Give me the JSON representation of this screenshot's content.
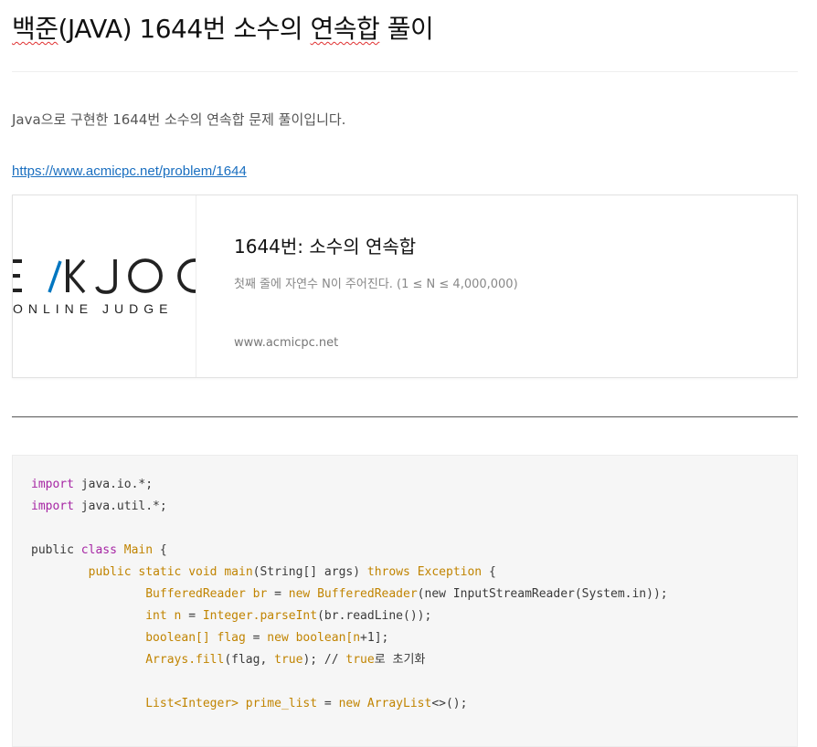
{
  "post": {
    "title_part1": "백준",
    "title_part2": "(JAVA) 1644번 소수의 ",
    "title_part3": "연속합",
    "title_part4": " 풀이",
    "intro": "Java으로 구현한 1644번 소수의 연속합 문제 풀이입니다.",
    "link": "https://www.acmicpc.net/problem/1644"
  },
  "card": {
    "logo_main": "EKJOO",
    "logo_sub": "ONLINE JUDGE",
    "title": "1644번: 소수의 연속합",
    "description": "첫째 줄에 자연수 N이 주어진다. (1 ≤ N ≤ 4,000,000)",
    "site": "www.acmicpc.net"
  },
  "code": {
    "lines": [
      [
        {
          "t": "import",
          "c": "kw"
        },
        {
          "t": " java.io.*;",
          "c": "plain"
        }
      ],
      [
        {
          "t": "import",
          "c": "kw"
        },
        {
          "t": " java.util.*;",
          "c": "plain"
        }
      ],
      [],
      [
        {
          "t": "public ",
          "c": "plain"
        },
        {
          "t": "class",
          "c": "kw"
        },
        {
          "t": " ",
          "c": "plain"
        },
        {
          "t": "Main",
          "c": "yk"
        },
        {
          "t": " {",
          "c": "plain"
        }
      ],
      [
        {
          "t": "        ",
          "c": "plain"
        },
        {
          "t": "public static void",
          "c": "yk"
        },
        {
          "t": " ",
          "c": "plain"
        },
        {
          "t": "main",
          "c": "yk"
        },
        {
          "t": "(String[] args) ",
          "c": "plain"
        },
        {
          "t": "throws",
          "c": "yk"
        },
        {
          "t": " ",
          "c": "plain"
        },
        {
          "t": "Exception",
          "c": "yk"
        },
        {
          "t": " {",
          "c": "plain"
        }
      ],
      [
        {
          "t": "                ",
          "c": "plain"
        },
        {
          "t": "BufferedReader br",
          "c": "yk"
        },
        {
          "t": " = ",
          "c": "plain"
        },
        {
          "t": "new BufferedReader",
          "c": "yk"
        },
        {
          "t": "(new InputStreamReader(System.in));",
          "c": "plain"
        }
      ],
      [
        {
          "t": "                ",
          "c": "plain"
        },
        {
          "t": "int n",
          "c": "yk"
        },
        {
          "t": " = ",
          "c": "plain"
        },
        {
          "t": "Integer.parseInt",
          "c": "yk"
        },
        {
          "t": "(br.readLine());",
          "c": "plain"
        }
      ],
      [
        {
          "t": "                ",
          "c": "plain"
        },
        {
          "t": "boolean[] flag",
          "c": "yk"
        },
        {
          "t": " = ",
          "c": "plain"
        },
        {
          "t": "new boolean[n",
          "c": "yk"
        },
        {
          "t": "+1];",
          "c": "plain"
        }
      ],
      [
        {
          "t": "                ",
          "c": "plain"
        },
        {
          "t": "Arrays.fill",
          "c": "yk"
        },
        {
          "t": "(flag, ",
          "c": "plain"
        },
        {
          "t": "true",
          "c": "yk"
        },
        {
          "t": "); // ",
          "c": "plain"
        },
        {
          "t": "true",
          "c": "yk"
        },
        {
          "t": "로 초기화",
          "c": "plain"
        }
      ],
      [],
      [
        {
          "t": "                ",
          "c": "plain"
        },
        {
          "t": "List<Integer> prime_list",
          "c": "yk"
        },
        {
          "t": " = ",
          "c": "plain"
        },
        {
          "t": "new ArrayList",
          "c": "yk"
        },
        {
          "t": "<>();",
          "c": "plain"
        }
      ]
    ]
  },
  "colors": {
    "link": "#1a6fc0",
    "keyword_purple": "#a626a4",
    "keyword_gold": "#c18401",
    "logo_accent": "#0076c0"
  }
}
